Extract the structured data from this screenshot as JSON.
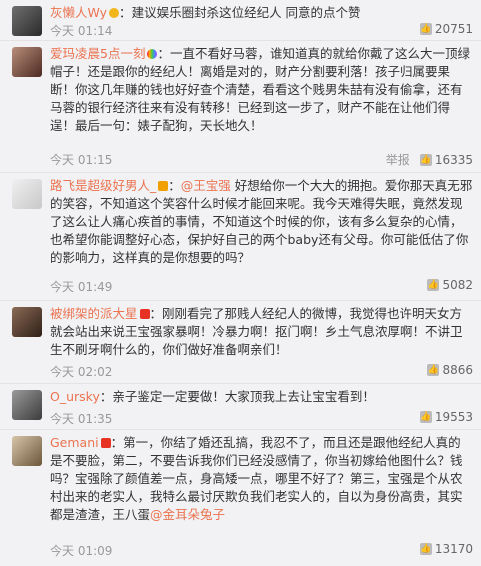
{
  "comments": [
    {
      "user": "灰懒人Wy",
      "text": "建议娱乐圈封杀这位经纪人 同意的点个赞",
      "time": "今天 01:14",
      "likes": "20751",
      "report": "",
      "badge": "gold"
    },
    {
      "user": "爱玛凌晨5点一刻",
      "text": "一直不看好马蓉，谁知道真的就给你戴了这么大一顶绿帽子！还是跟你的经纪人！离婚是对的，财产分割要利落！孩子归属要果断！你这几年赚的钱也好好查个清楚，看看这个贱男朱喆有没有偷拿，还有马蓉的银行经济往来有没有转移！已经到这一步了，财产不能在让他们得逞！最后一句：婊子配狗，天长地久！",
      "time": "今天 01:15",
      "likes": "16335",
      "report": "举报",
      "badge": "rainbow"
    },
    {
      "user": "路飞是超级好男人_",
      "mention": "@王宝强",
      "text": "好想给你一个大大的拥抱。爱你那天真无邪的笑容，不知道这个笑容什么时候才能回来呢。我今天难得失眠，竟然发现了这么让人痛心疾首的事情，不知道这个时候的你，该有多么复杂的心情，也希望你能调整好心态，保护好自己的两个baby还有父母。你可能低估了你的影响力，这样真的是你想要的吗？",
      "time": "今天 01:49",
      "likes": "5082",
      "report": "",
      "badge": "star"
    },
    {
      "user": "被绑架的派大星",
      "text": "刚刚看完了那贱人经纪人的微博，我觉得也许明天女方就会站出来说王宝强家暴啊！冷暴力啊！抠门啊！乡土气息浓厚啊！不讲卫生不刷牙啊什么的，你们做好准备啊亲们！",
      "time": "今天 02:02",
      "likes": "8866",
      "report": "",
      "badge": "flag"
    },
    {
      "user": "O_ursky",
      "text": "亲子鉴定一定要做！大家顶我上去让宝宝看到！",
      "time": "今天 01:35",
      "likes": "19553",
      "report": "",
      "badge": ""
    },
    {
      "user": "Gemani",
      "text": "第一，你结了婚还乱搞，我忍不了，而且还是跟他经纪人真的是不要脸，第二，不要告诉我你们已经没感情了，你当初嫁给他图什么？钱吗？宝强除了颜值差一点，身高矮一点，哪里不好了？第三，宝强是个从农村出来的老实人，我特么最讨厌欺负我们老实人的，自以为身份高贵，其实都是渣渣，王八蛋",
      "mention": "@金耳朵兔子",
      "time": "今天 01:09",
      "likes": "13170",
      "report": "",
      "badge": "flag"
    }
  ]
}
